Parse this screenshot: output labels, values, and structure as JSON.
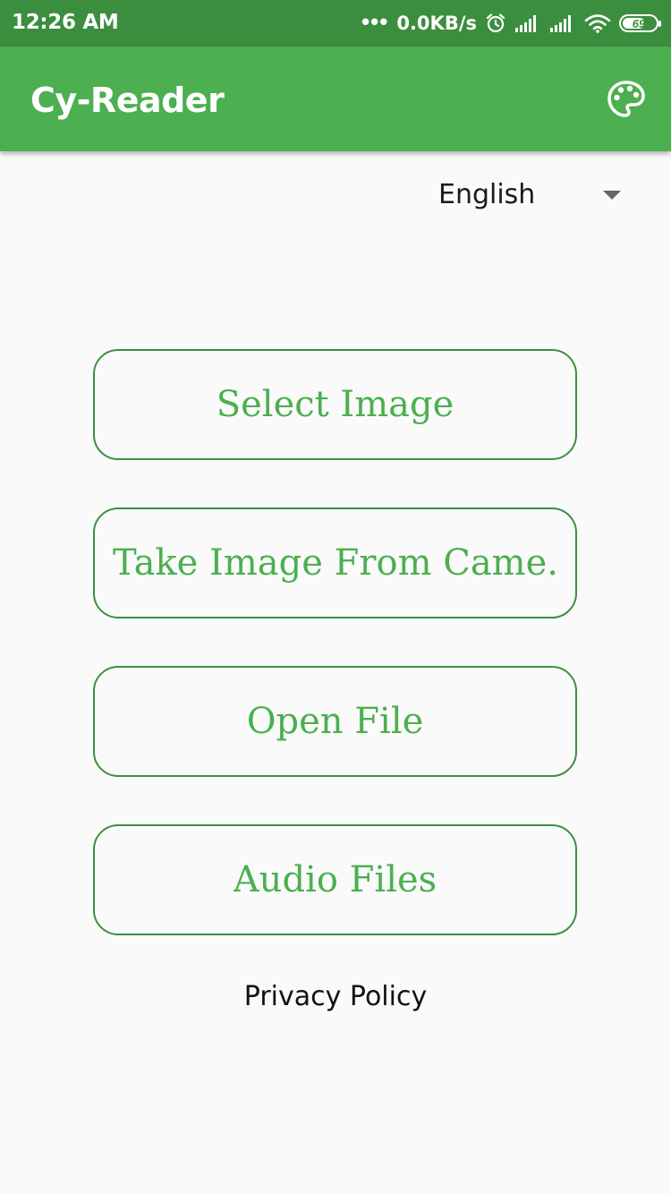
{
  "status_bar": {
    "time": "12:26 AM",
    "dots": "•••",
    "network_speed": "0.0KB/s",
    "alarm_icon": "alarm-clock-icon",
    "signal_icon_1": "cell-signal-icon",
    "signal_icon_2": "cell-signal-icon",
    "wifi_icon": "wifi-icon",
    "battery_level": "69",
    "battery_fraction": 0.69
  },
  "app_bar": {
    "title": "Cy-Reader",
    "theme_icon": "palette-icon",
    "background_color": "#4caf50"
  },
  "language_selector": {
    "selected": "English"
  },
  "actions": {
    "select_image": "Select Image",
    "take_image_from_camera": "Take Image From Came..",
    "open_file": "Open File",
    "audio_files": "Audio Files"
  },
  "footer": {
    "privacy_policy": "Privacy Policy"
  },
  "colors": {
    "status_bar": "#3b8e3e",
    "accent": "#4caf50",
    "button_border": "#3e8e41",
    "background": "#fafafa"
  }
}
